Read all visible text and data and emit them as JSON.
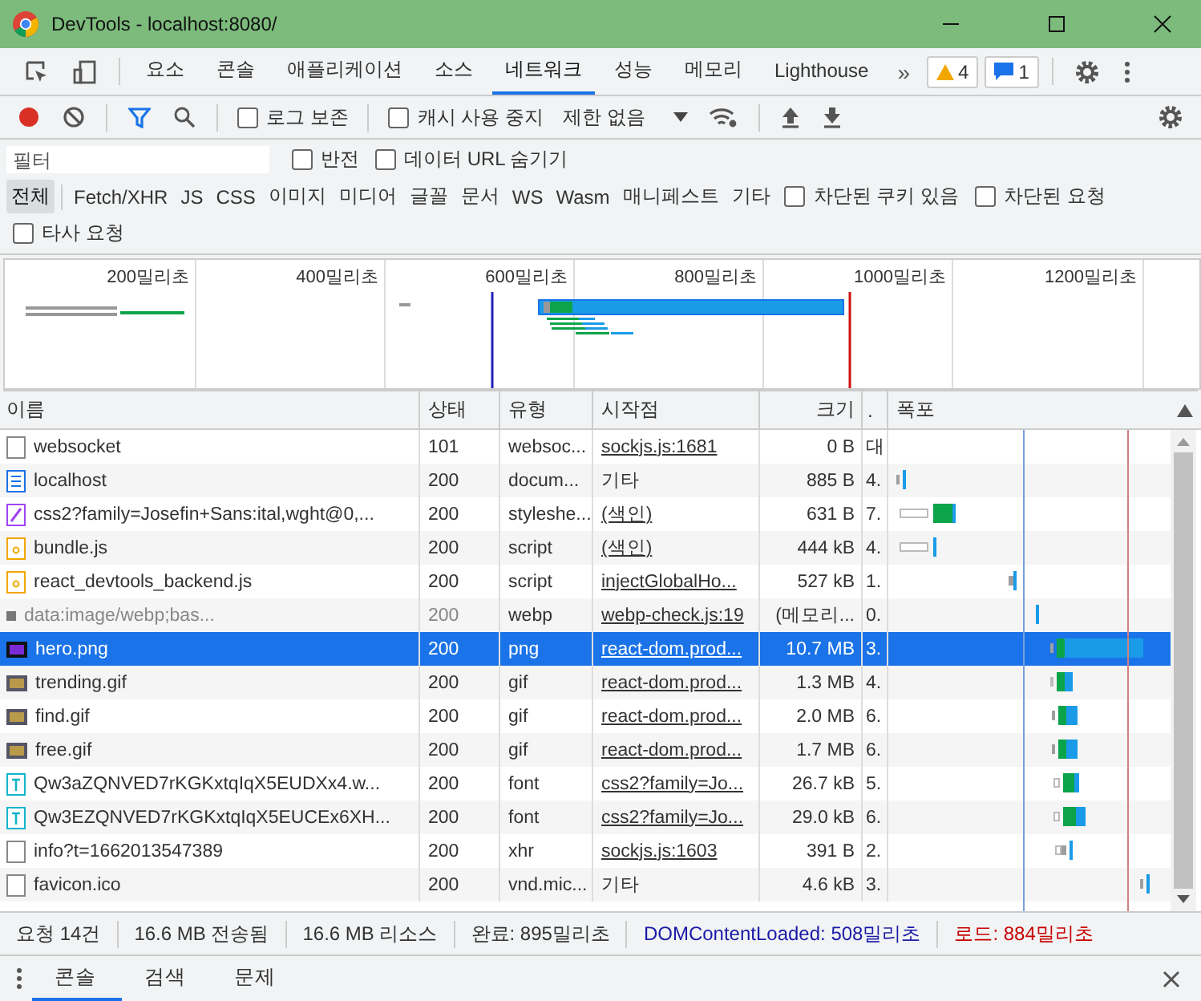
{
  "window": {
    "title": "DevTools - localhost:8080/"
  },
  "panel_tabs": [
    {
      "label": "요소",
      "selected": false
    },
    {
      "label": "콘솔",
      "selected": false
    },
    {
      "label": "애플리케이션",
      "selected": false
    },
    {
      "label": "소스",
      "selected": false
    },
    {
      "label": "네트워크",
      "selected": true
    },
    {
      "label": "성능",
      "selected": false
    },
    {
      "label": "메모리",
      "selected": false
    },
    {
      "label": "Lighthouse",
      "selected": false
    }
  ],
  "more_tabs": "»",
  "warnings": "4",
  "messages": "1",
  "toolbar": {
    "recording": true,
    "filter_on": true,
    "preserve_log": {
      "label": "로그 보존",
      "checked": false
    },
    "disable_cache": {
      "label": "캐시 사용 중지",
      "checked": false
    },
    "throttling": "제한 없음"
  },
  "filter": {
    "placeholder": "필터",
    "invert": {
      "label": "반전",
      "checked": false
    },
    "hide_data_urls": {
      "label": "데이터 URL 숨기기",
      "checked": false
    }
  },
  "type_filters": [
    {
      "label": "전체",
      "selected": true
    },
    {
      "label": "Fetch/XHR",
      "selected": false
    },
    {
      "label": "JS",
      "selected": false
    },
    {
      "label": "CSS",
      "selected": false
    },
    {
      "label": "이미지",
      "selected": false
    },
    {
      "label": "미디어",
      "selected": false
    },
    {
      "label": "글꼴",
      "selected": false
    },
    {
      "label": "문서",
      "selected": false
    },
    {
      "label": "WS",
      "selected": false
    },
    {
      "label": "Wasm",
      "selected": false
    },
    {
      "label": "매니페스트",
      "selected": false
    },
    {
      "label": "기타",
      "selected": false
    }
  ],
  "blocked_cookies": {
    "label": "차단된 쿠키 있음",
    "checked": false
  },
  "blocked_requests": {
    "label": "차단된 요청",
    "checked": false
  },
  "third_party": {
    "label": "타사 요청",
    "checked": false
  },
  "overview": {
    "ticks": [
      "200밀리초",
      "400밀리초",
      "600밀리초",
      "800밀리초",
      "1000밀리초",
      "1200밀리초"
    ]
  },
  "table": {
    "columns": [
      "이름",
      "상태",
      "유형",
      "시작점",
      "크기",
      ".",
      "폭포"
    ],
    "rows": [
      {
        "kind": "blank",
        "name": "websocket",
        "status": "101",
        "type": "websoc...",
        "initiator": "sockjs.js:1681",
        "initiator_link": true,
        "size": "0 B",
        "column_6": "대",
        "selected": false,
        "dimmed": false
      },
      {
        "kind": "document",
        "name": "localhost",
        "status": "200",
        "type": "docum...",
        "initiator": "기타",
        "initiator_link": false,
        "size": "885 B",
        "column_6": "4.",
        "selected": false,
        "dimmed": false
      },
      {
        "kind": "stylesheet",
        "name": "css2?family=Josefin+Sans:ital,wght@0,...",
        "status": "200",
        "type": "styleshe...",
        "initiator": "(색인)",
        "initiator_link": true,
        "size": "631 B",
        "column_6": "7.",
        "selected": false,
        "dimmed": false
      },
      {
        "kind": "script",
        "name": "bundle.js",
        "status": "200",
        "type": "script",
        "initiator": "(색인)",
        "initiator_link": true,
        "size": "444 kB",
        "column_6": "4.",
        "selected": false,
        "dimmed": false
      },
      {
        "kind": "script",
        "name": "react_devtools_backend.js",
        "status": "200",
        "type": "script",
        "initiator": "injectGlobalHo...",
        "initiator_link": true,
        "size": "527 kB",
        "column_6": "1.",
        "selected": false,
        "dimmed": false
      },
      {
        "kind": "data",
        "name": "data:image/webp;bas...",
        "status": "200",
        "type": "webp",
        "initiator": "webp-check.js:19",
        "initiator_link": true,
        "size": "(메모리...",
        "column_6": "0.",
        "selected": false,
        "dimmed": true
      },
      {
        "kind": "image",
        "name": "hero.png",
        "status": "200",
        "type": "png",
        "initiator": "react-dom.prod...",
        "initiator_link": true,
        "size": "10.7 MB",
        "column_6": "3.",
        "selected": true,
        "dimmed": false
      },
      {
        "kind": "image",
        "name": "trending.gif",
        "status": "200",
        "type": "gif",
        "initiator": "react-dom.prod...",
        "initiator_link": true,
        "size": "1.3 MB",
        "column_6": "4.",
        "selected": false,
        "dimmed": false
      },
      {
        "kind": "image",
        "name": "find.gif",
        "status": "200",
        "type": "gif",
        "initiator": "react-dom.prod...",
        "initiator_link": true,
        "size": "2.0 MB",
        "column_6": "6.",
        "selected": false,
        "dimmed": false
      },
      {
        "kind": "image",
        "name": "free.gif",
        "status": "200",
        "type": "gif",
        "initiator": "react-dom.prod...",
        "initiator_link": true,
        "size": "1.7 MB",
        "column_6": "6.",
        "selected": false,
        "dimmed": false
      },
      {
        "kind": "font",
        "name": "Qw3aZQNVED7rKGKxtqIqX5EUDXx4.w...",
        "status": "200",
        "type": "font",
        "initiator": "css2?family=Jo...",
        "initiator_link": true,
        "size": "26.7 kB",
        "column_6": "5.",
        "selected": false,
        "dimmed": false
      },
      {
        "kind": "font",
        "name": "Qw3EZQNVED7rKGKxtqIqX5EUCEx6XH...",
        "status": "200",
        "type": "font",
        "initiator": "css2?family=Jo...",
        "initiator_link": true,
        "size": "29.0 kB",
        "column_6": "6.",
        "selected": false,
        "dimmed": false
      },
      {
        "kind": "blank",
        "name": "info?t=1662013547389",
        "status": "200",
        "type": "xhr",
        "initiator": "sockjs.js:1603",
        "initiator_link": true,
        "size": "391 B",
        "column_6": "2.",
        "selected": false,
        "dimmed": false
      },
      {
        "kind": "blank",
        "name": "favicon.ico",
        "status": "200",
        "type": "vnd.mic...",
        "initiator": "기타",
        "initiator_link": false,
        "size": "4.6 kB",
        "column_6": "3.",
        "selected": false,
        "dimmed": false
      }
    ]
  },
  "status_bar": [
    {
      "kind": "plain",
      "text": "요청 14건"
    },
    {
      "kind": "plain",
      "text": "16.6 MB 전송됨"
    },
    {
      "kind": "plain",
      "text": "16.6 MB 리소스"
    },
    {
      "kind": "plain",
      "text": "완료: 895밀리초"
    },
    {
      "kind": "dom",
      "text": "DOMContentLoaded: 508밀리초"
    },
    {
      "kind": "load",
      "text": "로드: 884밀리초"
    }
  ],
  "drawer_tabs": [
    {
      "label": "콘솔",
      "selected": true
    },
    {
      "label": "검색",
      "selected": false
    },
    {
      "label": "문제",
      "selected": false
    }
  ]
}
